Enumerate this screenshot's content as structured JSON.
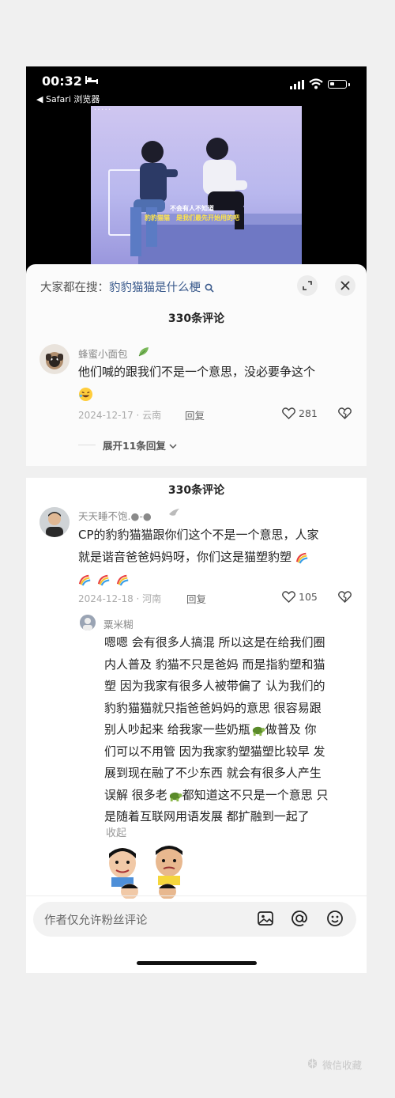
{
  "status_bar": {
    "time": "00:32",
    "back_app": "◀ Safari 浏览器"
  },
  "video": {
    "subtitle_line1": "不会有人不知道",
    "subtitle_line2a": "豹豹猫猫",
    "subtitle_line2b": "是我们最先开始用的吧"
  },
  "search_bar": {
    "prefix": "大家都在搜：",
    "keyword": "豹豹猫猫是什么梗"
  },
  "comment_count": "330条评论",
  "shot1_comment": {
    "username": "蜂蜜小面包",
    "text_line1": "他们喊的跟我们不是一个意思，没必要争这个",
    "date_location": "2024-12-17 · 云南",
    "reply_label": "回复",
    "likes": "281",
    "expand_label": "展开11条回复"
  },
  "shot2_comment": {
    "username": "天天睡不饱.●-●",
    "text_line1": "CP的豹豹猫猫跟你们这个不是一个意思，人家",
    "text_line2": "就是谐音爸爸妈妈呀，你们这是猫塑豹塑",
    "date_location": "2024-12-18 · 河南",
    "reply_label": "回复",
    "likes": "105"
  },
  "reply": {
    "username": "粟米糊",
    "lines": [
      "嗯嗯 会有很多人搞混 所以这是在给我们圈",
      "内人普及 豹猫不只是爸妈 而是指豹塑和猫",
      "塑 因为我家有很多人被带偏了 认为我们的",
      "豹豹猫猫就只指爸爸妈妈的意思 很容易跟",
      "别人吵起来 给我家一些奶瓶",
      "做普及  你",
      "们可以不用管 因为我家豹塑猫塑比较早 发",
      "展到现在融了不少东西 就会有很多人产生",
      "误解 很多老",
      "都知道这不只是一个意思 只",
      "是随着互联网用语发展 都扩融到一起了"
    ],
    "collapse_label": "收起"
  },
  "input_bar": {
    "placeholder": "作者仅允许粉丝评论"
  },
  "watermark": "微信收藏",
  "colors": {
    "keyword": "#3a5a8c",
    "accent_black": "#111111",
    "muted": "#aaaaaa"
  },
  "icons": [
    "bed-icon",
    "signal-icon",
    "wifi-icon",
    "battery-icon",
    "search-icon",
    "collapse-icon",
    "close-icon",
    "leaf-icon",
    "laugh-emoji-icon",
    "heart-icon",
    "dislike-heart-icon",
    "chevron-down-icon",
    "bird-icon",
    "rainbow-icon",
    "turtle-icon",
    "image-icon",
    "at-icon",
    "smiley-icon",
    "wechat-favorites-icon"
  ]
}
